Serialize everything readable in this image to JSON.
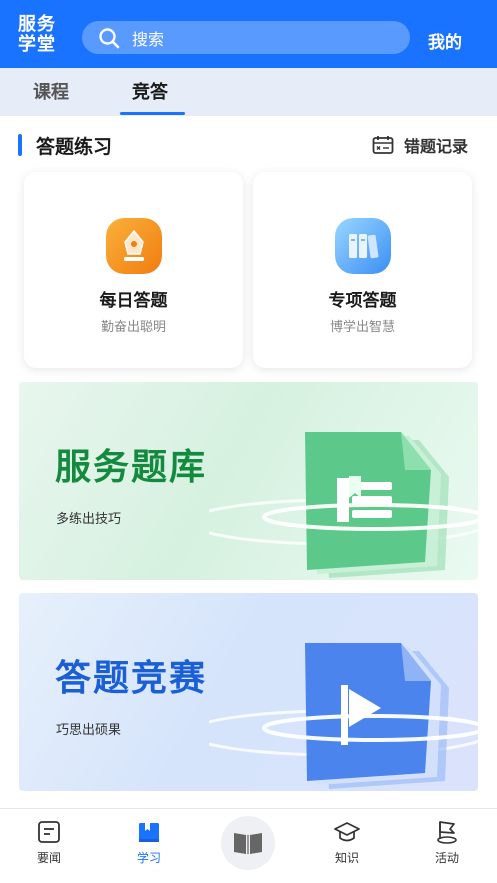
{
  "header": {
    "logo_line1": "服务",
    "logo_line2": "学堂",
    "search_placeholder": "搜索",
    "mine_label": "我的"
  },
  "tabs": [
    {
      "label": "课程",
      "active": false
    },
    {
      "label": "竞答",
      "active": true
    }
  ],
  "section": {
    "title": "答题练习",
    "mistakes_label": "错题记录"
  },
  "cards": [
    {
      "title": "每日答题",
      "subtitle": "勤奋出聪明",
      "icon": "pen-nib-icon",
      "color": "#f7941d"
    },
    {
      "title": "专项答题",
      "subtitle": "博学出智慧",
      "icon": "books-icon",
      "color": "#3a9bf5"
    }
  ],
  "banners": [
    {
      "title": "服务题库",
      "subtitle": "多练出技巧",
      "icon": "document-bookmark-icon",
      "color": "#148a3e"
    },
    {
      "title": "答题竞赛",
      "subtitle": "巧思出硕果",
      "icon": "document-play-icon",
      "color": "#1a5fd6"
    }
  ],
  "bottom_nav": [
    {
      "label": "要闻",
      "icon": "news-icon",
      "active": false
    },
    {
      "label": "学习",
      "icon": "book-study-icon",
      "active": true
    },
    {
      "label": "",
      "icon": "open-book-icon",
      "active": false
    },
    {
      "label": "知识",
      "icon": "graduation-cap-icon",
      "active": false
    },
    {
      "label": "活动",
      "icon": "activity-flag-icon",
      "active": false
    }
  ],
  "colors": {
    "accent": "#1a73ff",
    "green": "#148a3e",
    "blue_title": "#1a5fd6"
  }
}
